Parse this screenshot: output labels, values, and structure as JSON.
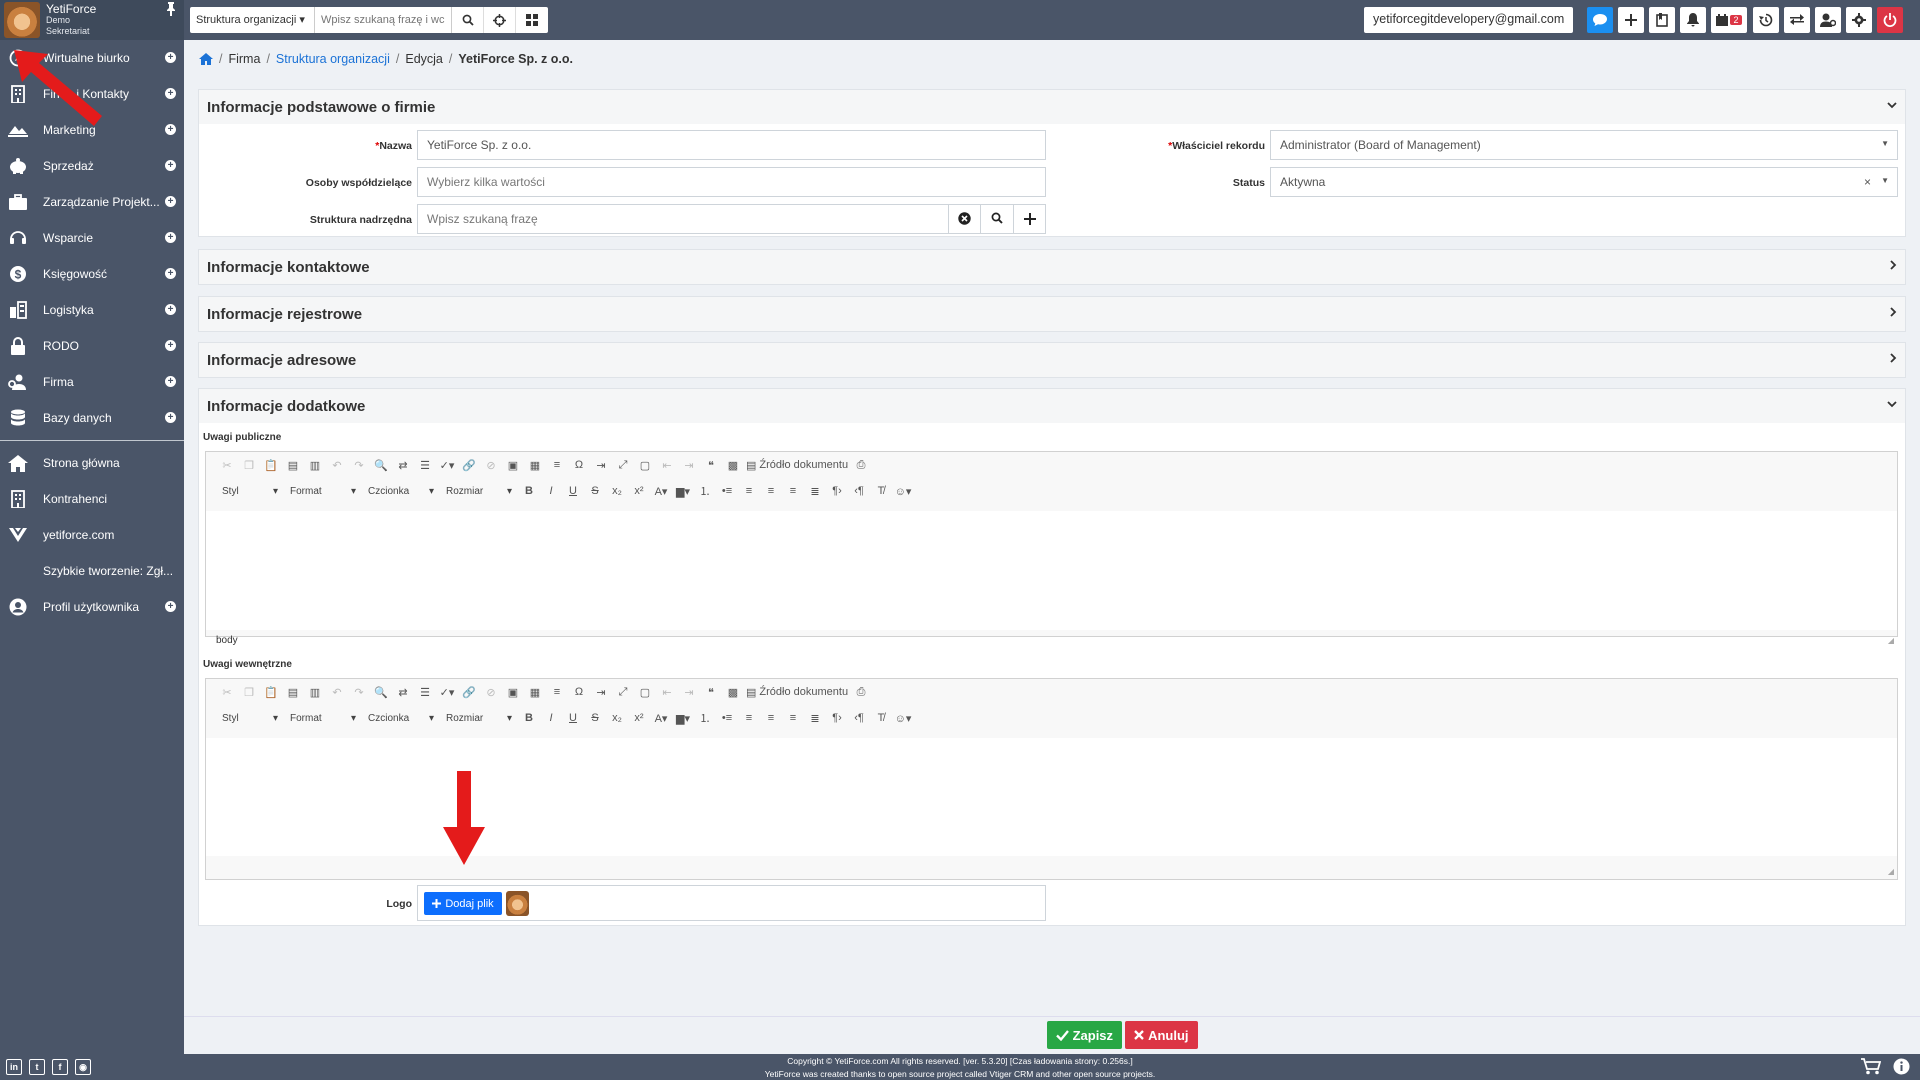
{
  "user": {
    "name": "YetiForce",
    "line1": "Demo",
    "line2": "Sekretariat"
  },
  "sidebar": {
    "items": [
      {
        "label": "Wirtualne biurko",
        "icon": "compass-icon",
        "plus": true
      },
      {
        "label": "Firmy i Kontakty",
        "icon": "building-icon",
        "plus": true
      },
      {
        "label": "Marketing",
        "icon": "marketing-icon",
        "plus": true
      },
      {
        "label": "Sprzedaż",
        "icon": "piggy-bank-icon",
        "plus": true
      },
      {
        "label": "Zarządzanie Projekt...",
        "icon": "briefcase-icon",
        "plus": true
      },
      {
        "label": "Wsparcie",
        "icon": "headset-icon",
        "plus": true
      },
      {
        "label": "Księgowość",
        "icon": "dollar-icon",
        "plus": true
      },
      {
        "label": "Logistyka",
        "icon": "warehouse-icon",
        "plus": true
      },
      {
        "label": "RODO",
        "icon": "lock-icon",
        "plus": true
      },
      {
        "label": "Firma",
        "icon": "user-cog-icon",
        "plus": true
      },
      {
        "label": "Bazy danych",
        "icon": "database-icon",
        "plus": true
      }
    ],
    "items2": [
      {
        "label": "Strona główna",
        "icon": "home-icon",
        "plus": false
      },
      {
        "label": "Kontrahenci",
        "icon": "building-icon",
        "plus": false
      },
      {
        "label": "yetiforce.com",
        "icon": "yeti-icon",
        "plus": false
      },
      {
        "label": "Szybkie tworzenie: Zgł...",
        "icon": "",
        "plus": false
      },
      {
        "label": "Profil użytkownika",
        "icon": "user-circle-icon",
        "plus": true
      }
    ]
  },
  "topbar": {
    "search_module": "Struktura organizacji",
    "search_placeholder": "Wpisz szukaną frazę i wciśnij",
    "email": "yetiforcegitdevelopery@gmail.com",
    "calendar_badge": "2"
  },
  "breadcrumb": {
    "firma": "Firma",
    "struktura": "Struktura organizacji",
    "edycja": "Edycja",
    "current": "YetiForce Sp. z o.o."
  },
  "blocks": {
    "basic": "Informacje podstawowe o firmie",
    "contact": "Informacje kontaktowe",
    "registry": "Informacje rejestrowe",
    "address": "Informacje adresowe",
    "additional": "Informacje dodatkowe"
  },
  "form": {
    "name_label": "Nazwa",
    "name_value": "YetiForce Sp. z o.o.",
    "shared_label": "Osoby współdzielące",
    "shared_placeholder": "Wybierz kilka wartości",
    "parent_label": "Struktura nadrzędna",
    "parent_placeholder": "Wpisz szukaną frazę",
    "owner_label": "Właściciel rekordu",
    "owner_value": "Administrator (Board of Management)",
    "status_label": "Status",
    "status_value": "Aktywna",
    "public_notes_label": "Uwagi publiczne",
    "internal_notes_label": "Uwagi wewnętrzne",
    "logo_label": "Logo",
    "add_file": "Dodaj plik"
  },
  "editor": {
    "source": "Źródło dokumentu",
    "style": "Styl",
    "format": "Format",
    "font": "Czcionka",
    "size": "Rozmiar",
    "path": "body"
  },
  "buttons": {
    "save": "Zapisz",
    "cancel": "Anuluj"
  },
  "footer": {
    "line1": "Copyright © YetiForce.com All rights reserved. [ver. 5.3.20] [Czas ładowania strony: 0.256s.]",
    "line2": "YetiForce was created thanks to open source project called Vtiger CRM and other open source projects."
  },
  "colors": {
    "sidebar": "#4a5568",
    "link": "#1b72d6",
    "save": "#28a745",
    "cancel": "#dc3545",
    "primary": "#0d6efd",
    "annotation": "#e41b1b"
  }
}
